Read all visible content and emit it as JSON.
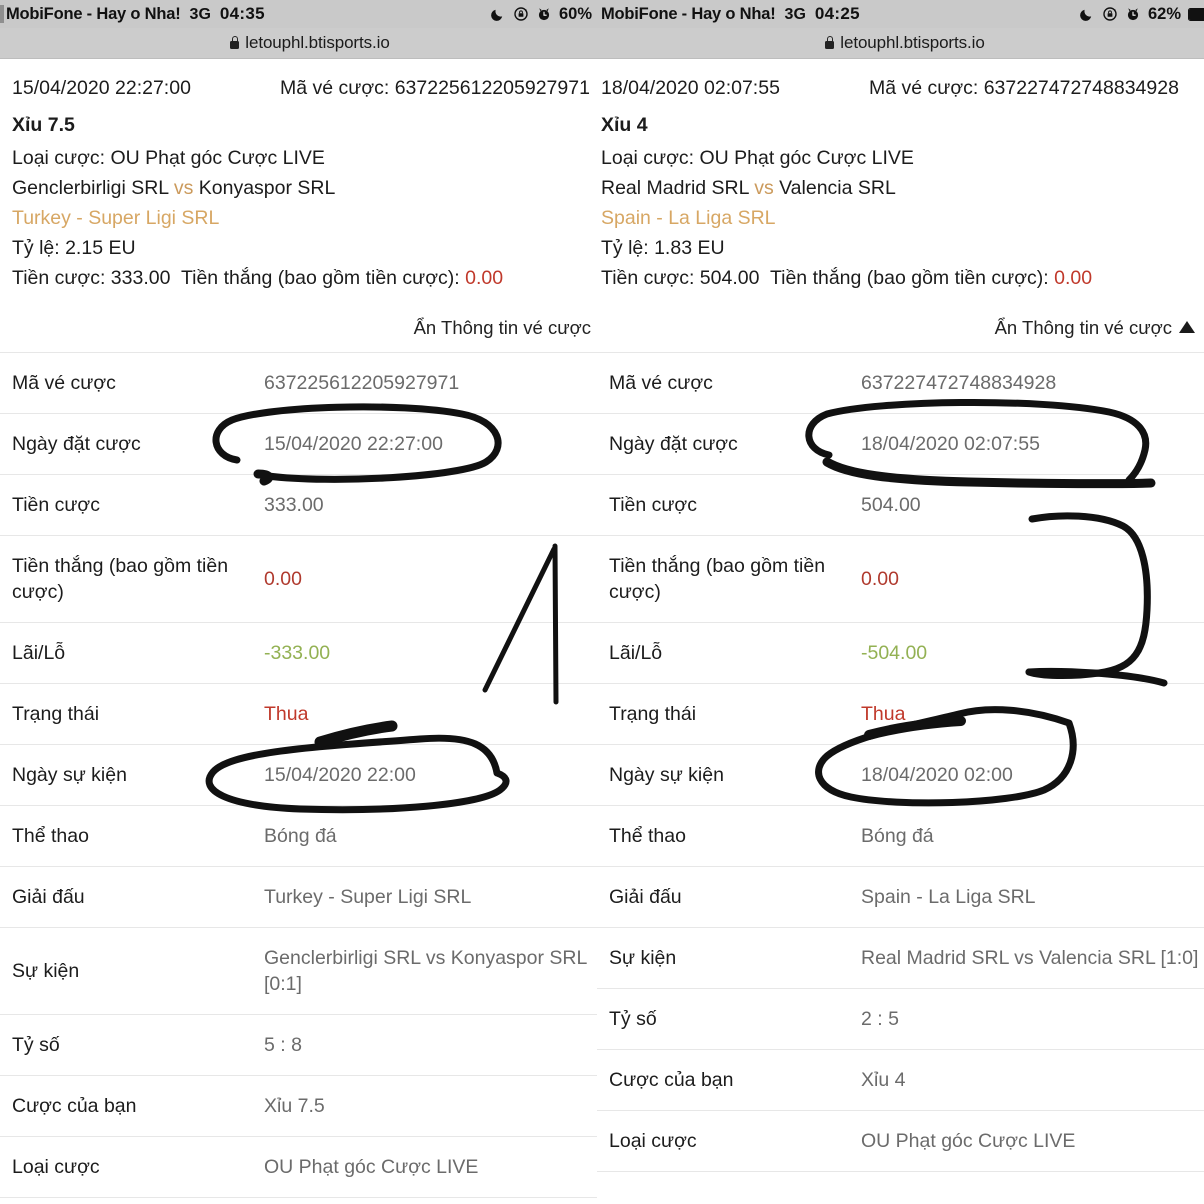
{
  "panels": [
    {
      "id": "left",
      "status_bar": {
        "carrier": "MobiFone - Hay o Nha!",
        "network": "3G",
        "time": "04:35",
        "battery": "60%",
        "icons": [
          "moon-icon",
          "rotation-lock-icon",
          "alarm-clock-icon",
          "battery-icon"
        ]
      },
      "url_bar": {
        "lock": "lock-icon",
        "url": "letouphl.btisports.io"
      },
      "ticket_header": {
        "placed_at": "15/04/2020 22:27:00",
        "ticket_code_label": "Mã vé cược:",
        "ticket_code": "637225612205927971",
        "selection": "Xỉu 7.5",
        "bet_type_line": "Loại cược: OU Phạt góc Cược LIVE",
        "home_team": "Genclerbirligi SRL",
        "vs": "vs",
        "away_team": "Konyaspor SRL",
        "league": "Turkey - Super Ligi SRL",
        "odds_line": "Tỷ lệ: 2.15 EU",
        "stake_line": "Tiền cược: 333.00",
        "payout_label": "Tiền thắng (bao gồm tiền cược):",
        "payout_value": "0.00"
      },
      "collapse_toggle": {
        "label": "Ẩn Thông tin vé cược",
        "icon": "triangle-up-icon"
      },
      "detail_rows": [
        {
          "key": "Mã vé cược",
          "value": "637225612205927971",
          "style": ""
        },
        {
          "key": "Ngày đặt cược",
          "value": "15/04/2020 22:27:00",
          "style": ""
        },
        {
          "key": "Tiền cược",
          "value": "333.00",
          "style": ""
        },
        {
          "key": "Tiền thắng (bao gồm tiền cược)",
          "value": "0.00",
          "style": "zero"
        },
        {
          "key": "Lãi/Lỗ",
          "value": "-333.00",
          "style": "neg"
        },
        {
          "key": "Trạng thái",
          "value": "Thua",
          "style": "lose"
        },
        {
          "key": "Ngày sự kiện",
          "value": "15/04/2020 22:00",
          "style": ""
        },
        {
          "key": "Thể thao",
          "value": "Bóng đá",
          "style": ""
        },
        {
          "key": "Giải đấu",
          "value": "Turkey - Super Ligi SRL",
          "style": ""
        },
        {
          "key": "Sự kiện",
          "value": "Genclerbirligi SRL vs Konyaspor SRL [0:1]",
          "style": ""
        },
        {
          "key": "Tỷ số",
          "value": "5 : 8",
          "style": ""
        },
        {
          "key": "Cược của bạn",
          "value": "Xỉu 7.5",
          "style": ""
        },
        {
          "key": "Loại cược",
          "value": "OU Phạt góc Cược LIVE",
          "style": ""
        }
      ]
    },
    {
      "id": "right",
      "status_bar": {
        "carrier": "MobiFone - Hay o Nha!",
        "network": "3G",
        "time": "04:25",
        "battery": "62%",
        "icons": [
          "moon-icon",
          "rotation-lock-icon",
          "alarm-clock-icon",
          "battery-icon"
        ]
      },
      "url_bar": {
        "lock": "lock-icon",
        "url": "letouphl.btisports.io"
      },
      "ticket_header": {
        "placed_at": "18/04/2020 02:07:55",
        "ticket_code_label": "Mã vé cược:",
        "ticket_code": "637227472748834928",
        "selection": "Xỉu 4",
        "bet_type_line": "Loại cược: OU Phạt góc Cược LIVE",
        "home_team": "Real Madrid SRL",
        "vs": "vs",
        "away_team": "Valencia SRL",
        "league": "Spain - La Liga SRL",
        "odds_line": "Tỷ lệ: 1.83 EU",
        "stake_line": "Tiền cược: 504.00",
        "payout_label": "Tiền thắng (bao gồm tiền cược):",
        "payout_value": "0.00"
      },
      "collapse_toggle": {
        "label": "Ẩn Thông tin vé cược",
        "icon": "triangle-up-icon"
      },
      "detail_rows": [
        {
          "key": "Mã vé cược",
          "value": "637227472748834928",
          "style": ""
        },
        {
          "key": "Ngày đặt cược",
          "value": "18/04/2020 02:07:55",
          "style": ""
        },
        {
          "key": "Tiền cược",
          "value": "504.00",
          "style": ""
        },
        {
          "key": "Tiền thắng (bao gồm tiền cược)",
          "value": "0.00",
          "style": "zero"
        },
        {
          "key": "Lãi/Lỗ",
          "value": "-504.00",
          "style": "neg"
        },
        {
          "key": "Trạng thái",
          "value": "Thua",
          "style": "lose"
        },
        {
          "key": "Ngày sự kiện",
          "value": "18/04/2020 02:00",
          "style": ""
        },
        {
          "key": "Thể thao",
          "value": "Bóng đá",
          "style": ""
        },
        {
          "key": "Giải đấu",
          "value": "Spain - La Liga SRL",
          "style": ""
        },
        {
          "key": "Sự kiện",
          "value": "Real Madrid SRL vs Valencia SRL [1:0]",
          "style": ""
        },
        {
          "key": "Tỷ số",
          "value": "2 : 5",
          "style": ""
        },
        {
          "key": "Cược của bạn",
          "value": "Xỉu 4",
          "style": ""
        },
        {
          "key": "Loại cược",
          "value": "OU Phạt góc Cược LIVE",
          "style": ""
        }
      ]
    }
  ],
  "colors": {
    "accent_orange": "#d7a764",
    "loss_red": "#c0392b",
    "profit_green": "#93b153",
    "value_gray": "#6b6b6b",
    "statusbar_gray": "#c9c9c9",
    "row_divider": "#e7e7e7",
    "ink_black": "#111111"
  },
  "annotations": {
    "description": "hand-drawn black marker circles/strokes over date and status values",
    "marks": [
      "circle-around-ngay-dat-cuoc-value",
      "circle-around-ngay-su-kien-value",
      "stroke-near-tien-thang-value"
    ]
  }
}
